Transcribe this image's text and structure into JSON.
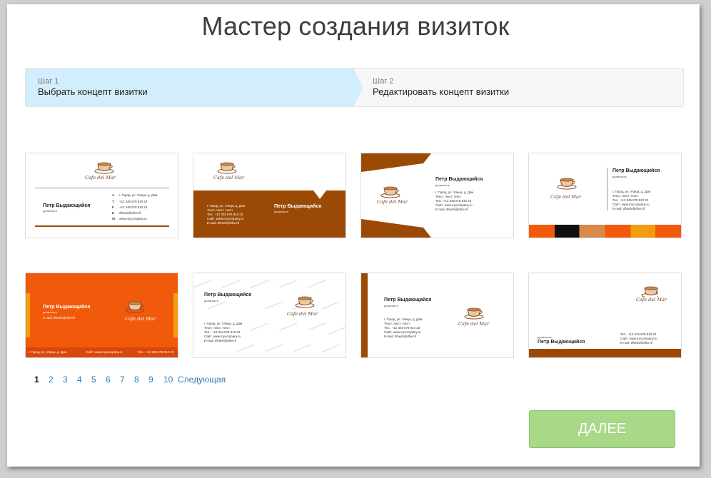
{
  "page": {
    "title": "Мастер создания визиток"
  },
  "steps": [
    {
      "num": "Шаг 1",
      "label": "Выбрать концепт визитки"
    },
    {
      "num": "Шаг 2",
      "label": "Редактировать концепт визитки"
    }
  ],
  "card": {
    "name": "Петр Выдающийся",
    "position": "должность",
    "logo_text": "Cafe del Mar",
    "address": "г. Город, ул. Улица, д. Дом",
    "phone_1": "+12 345 678 910 23",
    "phone_2": "+12 345 678 910 23",
    "email_short": "dfvedv@dfver.ll",
    "site_short": "www.mycompany.ru",
    "text_line": "Текст, текст, текст",
    "tel_line": "Тел.: +12 345 678 910 23",
    "site_line": "Сайт: www.mycompany.ru",
    "email_line": "E-mail: dfvedv@dfver.ll",
    "contact_letters": [
      "А",
      "Т",
      "F",
      "E",
      "W"
    ]
  },
  "pagination": {
    "current": "1",
    "pages": [
      "2",
      "3",
      "4",
      "5",
      "6",
      "7",
      "8",
      "9",
      "10"
    ],
    "next_label": "Следующая"
  },
  "next_button": {
    "label": "ДАЛЕЕ"
  },
  "colors": {
    "step_active": "#d2eefc",
    "brown": "#9b4a06",
    "orange": "#f05a0a",
    "button_green": "#a8d888"
  }
}
